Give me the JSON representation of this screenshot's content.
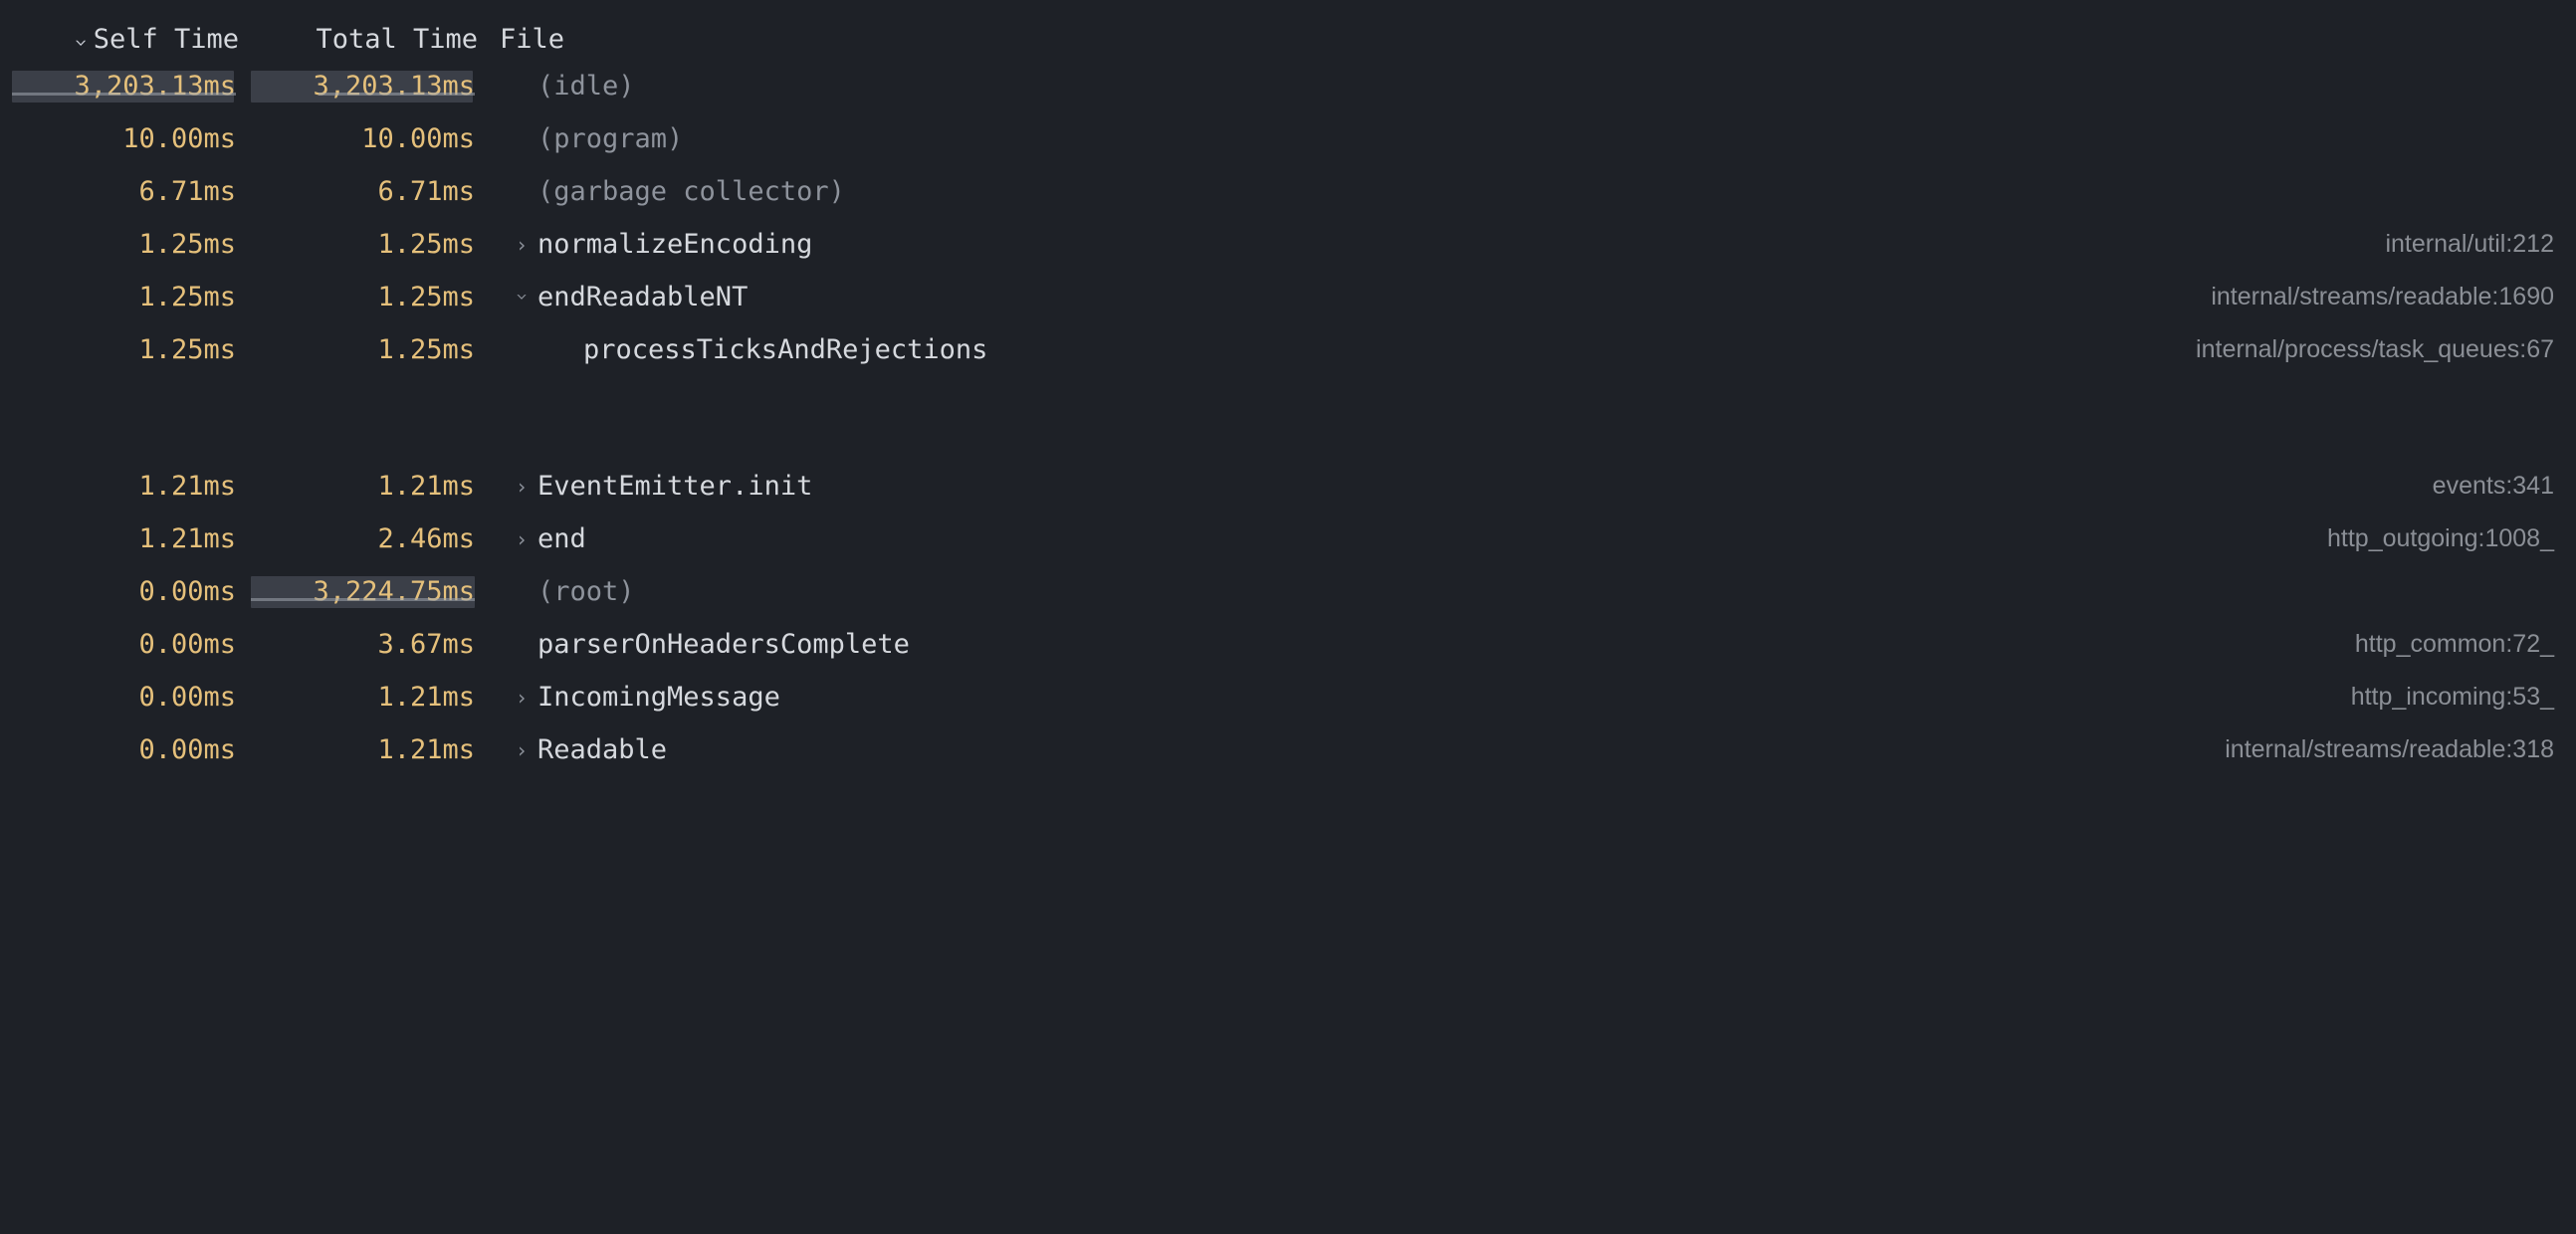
{
  "columns": {
    "self_time": "Self Time",
    "total_time": "Total Time",
    "file": "File"
  },
  "max_time_ms": 3224.75,
  "rows": [
    {
      "self_time": "3,203.13ms",
      "total_time": "3,203.13ms",
      "function": "(idle)",
      "file": "",
      "dim": true,
      "expand": "none",
      "indent": 0,
      "self_bar_pct": 99.3,
      "total_bar_pct": 99.3,
      "self_underline": true,
      "total_underline": true
    },
    {
      "self_time": "10.00ms",
      "total_time": "10.00ms",
      "function": "(program)",
      "file": "",
      "dim": true,
      "expand": "none",
      "indent": 0,
      "self_bar_pct": 0,
      "total_bar_pct": 0
    },
    {
      "self_time": "6.71ms",
      "total_time": "6.71ms",
      "function": "(garbage collector)",
      "file": "",
      "dim": true,
      "expand": "none",
      "indent": 0,
      "self_bar_pct": 0,
      "total_bar_pct": 0
    },
    {
      "self_time": "1.25ms",
      "total_time": "1.25ms",
      "function": "normalizeEncoding",
      "file": "internal/util:212",
      "dim": false,
      "expand": "closed",
      "indent": 0,
      "self_bar_pct": 0,
      "total_bar_pct": 0
    },
    {
      "self_time": "1.25ms",
      "total_time": "1.25ms",
      "function": "endReadableNT",
      "file": "internal/streams/readable:1690",
      "dim": false,
      "expand": "open",
      "indent": 0,
      "self_bar_pct": 0,
      "total_bar_pct": 0
    },
    {
      "self_time": "1.25ms",
      "total_time": "1.25ms",
      "function": "processTicksAndRejections",
      "file": "internal/process/task_queues:67",
      "dim": false,
      "expand": "none",
      "indent": 1,
      "self_bar_pct": 0,
      "total_bar_pct": 0
    },
    {
      "spacer": true
    },
    {
      "self_time": "1.21ms",
      "total_time": "1.21ms",
      "function": "EventEmitter.init",
      "file": "events:341",
      "dim": false,
      "expand": "closed",
      "indent": 0,
      "self_bar_pct": 0,
      "total_bar_pct": 0
    },
    {
      "self_time": "1.21ms",
      "total_time": "2.46ms",
      "function": "end",
      "file": "http_outgoing:1008_",
      "dim": false,
      "expand": "closed",
      "indent": 0,
      "self_bar_pct": 0,
      "total_bar_pct": 0
    },
    {
      "self_time": "0.00ms",
      "total_time": "3,224.75ms",
      "function": "(root)",
      "file": "",
      "dim": true,
      "expand": "none",
      "indent": 0,
      "self_bar_pct": 0,
      "total_bar_pct": 100,
      "total_underline": true
    },
    {
      "self_time": "0.00ms",
      "total_time": "3.67ms",
      "function": "parserOnHeadersComplete",
      "file": "http_common:72_",
      "dim": false,
      "expand": "none",
      "indent": 0,
      "self_bar_pct": 0,
      "total_bar_pct": 0
    },
    {
      "self_time": "0.00ms",
      "total_time": "1.21ms",
      "function": "IncomingMessage",
      "file": "http_incoming:53_",
      "dim": false,
      "expand": "closed",
      "indent": 0,
      "self_bar_pct": 0,
      "total_bar_pct": 0
    },
    {
      "self_time": "0.00ms",
      "total_time": "1.21ms",
      "function": "Readable",
      "file": "internal/streams/readable:318",
      "dim": false,
      "expand": "closed",
      "indent": 0,
      "self_bar_pct": 0,
      "total_bar_pct": 0
    }
  ]
}
